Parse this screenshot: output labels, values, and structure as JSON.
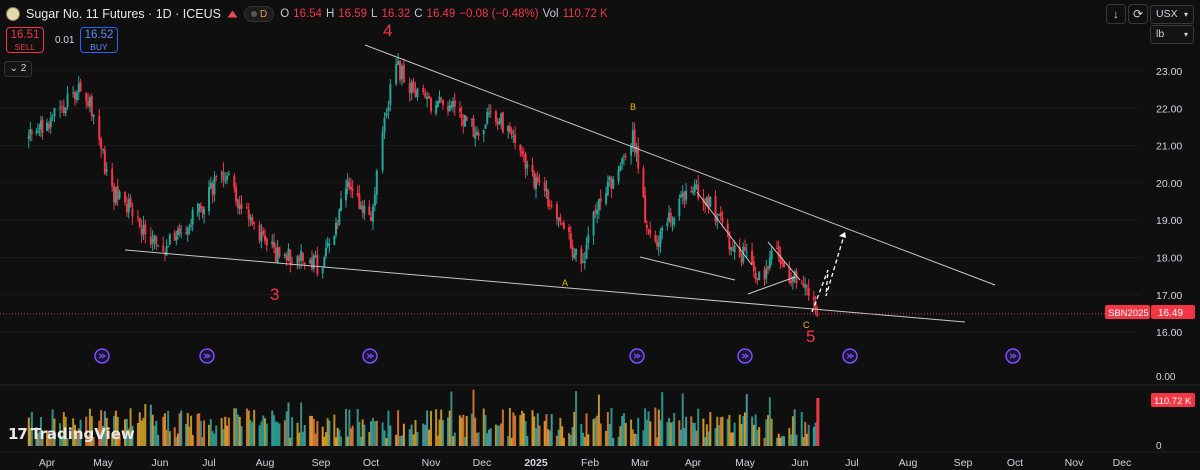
{
  "header": {
    "title": "Sugar No. 11 Futures · 1D · ICEUS",
    "d_badge": "D",
    "ohlc": [
      {
        "label": "O",
        "value": "16.54"
      },
      {
        "label": "H",
        "value": "16.59"
      },
      {
        "label": "L",
        "value": "16.32"
      },
      {
        "label": "C",
        "value": "16.49"
      }
    ],
    "change": "−0.08 (−0.48%)",
    "vol_label": "Vol",
    "vol_value": "110.72 K"
  },
  "trade": {
    "sell_price": "16.51",
    "sell_label": "SELL",
    "spread": "0.01",
    "buy_price": "16.52",
    "buy_label": "BUY"
  },
  "indicators_toggle": "2",
  "toolbar": {
    "currency": "USX",
    "unit": "lb"
  },
  "branding": "TradingView",
  "colors": {
    "up": "#26a69a",
    "down": "#f23645",
    "background": "#0f0f0f",
    "wave_label": "#f23645",
    "abc_label": "#f0b90b",
    "event_icon": "#7b4dff"
  },
  "chart_data": {
    "type": "candlestick",
    "symbol_tag": "SBN2025",
    "last_price": "16.49",
    "y_axis_ticks": [
      "23.00",
      "22.00",
      "21.00",
      "20.00",
      "19.00",
      "18.00",
      "17.00",
      "16.00"
    ],
    "ylim": [
      15.5,
      24.0
    ],
    "x_axis_ticks": [
      "Apr",
      "May",
      "Jun",
      "Jul",
      "Aug",
      "Sep",
      "Oct",
      "Nov",
      "Dec",
      "2025",
      "Feb",
      "Mar",
      "Apr",
      "May",
      "Jun",
      "Jul",
      "Aug",
      "Sep",
      "Oct",
      "Nov",
      "Dec"
    ],
    "wave_labels": [
      "3",
      "4",
      "5"
    ],
    "abc_labels": [
      "A",
      "B",
      "C"
    ],
    "volume": {
      "last": "110.72 K",
      "axis_ticks": [
        "0.00",
        "0"
      ]
    },
    "price_path": [
      [
        "2024-03-20",
        21.2
      ],
      [
        "2024-04-10",
        22.0
      ],
      [
        "2024-04-20",
        22.7
      ],
      [
        "2024-04-28",
        21.4
      ],
      [
        "2024-05-05",
        19.8
      ],
      [
        "2024-05-15",
        19.4
      ],
      [
        "2024-05-25",
        18.6
      ],
      [
        "2024-06-05",
        18.3
      ],
      [
        "2024-06-20",
        19.0
      ],
      [
        "2024-07-01",
        19.7
      ],
      [
        "2024-07-08",
        20.4
      ],
      [
        "2024-07-20",
        19.3
      ],
      [
        "2024-08-01",
        18.3
      ],
      [
        "2024-08-12",
        18.0
      ],
      [
        "2024-08-22",
        18.1
      ],
      [
        "2024-09-01",
        17.7
      ],
      [
        "2024-09-08",
        18.5
      ],
      [
        "2024-09-16",
        19.9
      ],
      [
        "2024-09-23",
        19.6
      ],
      [
        "2024-10-01",
        19.0
      ],
      [
        "2024-10-08",
        21.6
      ],
      [
        "2024-10-13",
        23.3
      ],
      [
        "2024-10-20",
        22.6
      ],
      [
        "2024-10-30",
        22.1
      ],
      [
        "2024-11-08",
        22.2
      ],
      [
        "2024-11-18",
        21.8
      ],
      [
        "2024-11-28",
        21.4
      ],
      [
        "2024-12-08",
        21.9
      ],
      [
        "2024-12-18",
        21.2
      ],
      [
        "2025-01-01",
        20.0
      ],
      [
        "2025-01-12",
        19.4
      ],
      [
        "2025-01-22",
        18.2
      ],
      [
        "2025-01-28",
        17.9
      ],
      [
        "2025-02-06",
        19.6
      ],
      [
        "2025-02-15",
        20.1
      ],
      [
        "2025-02-25",
        21.3
      ],
      [
        "2025-03-01",
        20.4
      ],
      [
        "2025-03-04",
        18.9
      ],
      [
        "2025-03-12",
        18.5
      ],
      [
        "2025-03-22",
        19.3
      ],
      [
        "2025-04-01",
        19.9
      ],
      [
        "2025-04-12",
        19.4
      ],
      [
        "2025-04-22",
        18.4
      ],
      [
        "2025-05-01",
        18.0
      ],
      [
        "2025-05-10",
        17.3
      ],
      [
        "2025-05-18",
        18.2
      ],
      [
        "2025-05-25",
        17.6
      ],
      [
        "2025-06-01",
        17.2
      ],
      [
        "2025-06-08",
        16.85
      ],
      [
        "2025-06-11",
        16.49
      ]
    ]
  }
}
